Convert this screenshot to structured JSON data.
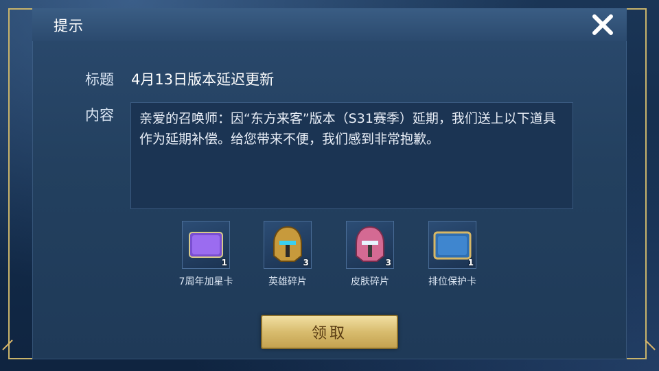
{
  "dialog": {
    "title": "提示",
    "title_label": "标题",
    "title_value": "4月13日版本延迟更新",
    "content_label": "内容",
    "content_text": "亲爱的召唤师：因“东方来客”版本（S31赛季）延期，我们送上以下道具作为延期补偿。给您带来不便，我们感到非常抱歉。",
    "claim_label": "领取"
  },
  "rewards": [
    {
      "name": "7周年加星卡",
      "count": "1",
      "icon": "star-card-icon",
      "badge": "7周年加星卡"
    },
    {
      "name": "英雄碎片",
      "count": "3",
      "icon": "hero-fragment-icon"
    },
    {
      "name": "皮肤碎片",
      "count": "3",
      "icon": "skin-fragment-icon"
    },
    {
      "name": "排位保护卡",
      "count": "1",
      "icon": "rank-protection-card-icon",
      "badge": "排位保护卡"
    }
  ],
  "colors": {
    "gold_border": "#c9b46b",
    "panel": "#23405f",
    "button": "#d8bc6e"
  }
}
